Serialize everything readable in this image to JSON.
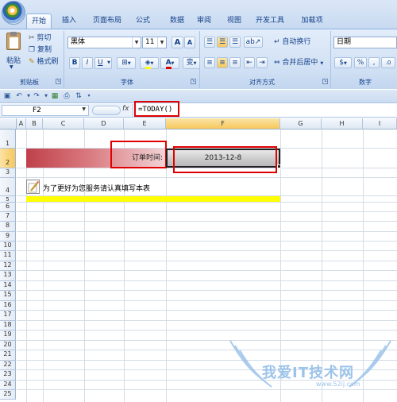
{
  "ribbon_tabs": [
    "开始",
    "插入",
    "页面布局",
    "公式",
    "数据",
    "审阅",
    "视图",
    "开发工具",
    "加载项"
  ],
  "clipboard": {
    "paste": "粘贴",
    "cut": "剪切",
    "copy": "复制",
    "format_painter": "格式刷",
    "group_label": "剪贴板"
  },
  "font": {
    "name": "黑体",
    "size": "11",
    "grow": "A",
    "shrink": "A",
    "bold": "B",
    "italic": "I",
    "underline": "U",
    "phonetic": "变",
    "font_color_letter": "A",
    "group_label": "字体"
  },
  "alignment": {
    "wrap_text": "自动换行",
    "merge_center": "合并后居中",
    "group_label": "对齐方式"
  },
  "number": {
    "format": "日期",
    "percent": "%",
    "comma": ",",
    "group_label": "数字"
  },
  "formula_bar": {
    "name_box": "F2",
    "fx": "fx",
    "formula": "=TODAY()"
  },
  "columns": [
    "A",
    "B",
    "C",
    "D",
    "E",
    "F",
    "G",
    "H",
    "I"
  ],
  "rows": [
    "1",
    "2",
    "3",
    "4",
    "5",
    "6",
    "7",
    "8",
    "9",
    "10",
    "11",
    "12",
    "13",
    "14",
    "15",
    "16",
    "17",
    "18",
    "19",
    "20",
    "21",
    "22",
    "23",
    "24",
    "25"
  ],
  "cells": {
    "order_time_label": "订单时间:",
    "order_date": "2013-12-8",
    "note": "为了更好为您服务请认真填写本表"
  },
  "watermark": {
    "title": "我爱IT技术网",
    "url": "www.52ij.com"
  },
  "colors": {
    "selection_outline": "#e00000",
    "highlight_yellow": "#ffff00",
    "banner_red": "#c0404a"
  }
}
